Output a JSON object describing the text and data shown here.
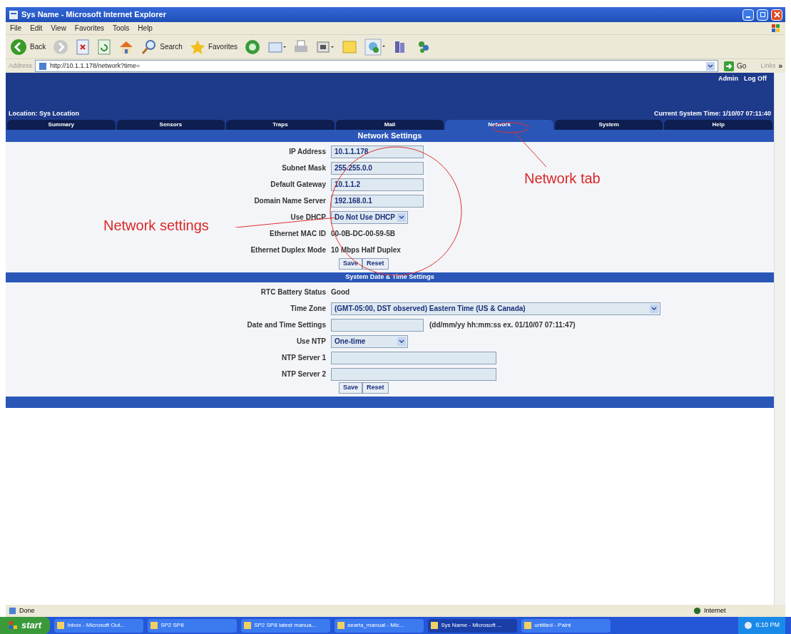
{
  "window": {
    "title": "Sys Name - Microsoft Internet Explorer"
  },
  "menu": [
    "File",
    "Edit",
    "View",
    "Favorites",
    "Tools",
    "Help"
  ],
  "toolbar": [
    {
      "kind": "back",
      "label": "Back"
    },
    {
      "kind": "forward"
    },
    {
      "kind": "stop"
    },
    {
      "kind": "refresh"
    },
    {
      "kind": "home"
    },
    {
      "kind": "search",
      "label": "Search"
    },
    {
      "kind": "favorites",
      "label": "Favorites"
    },
    {
      "kind": "media"
    },
    {
      "kind": "mail"
    },
    {
      "kind": "print"
    },
    {
      "kind": "edit"
    },
    {
      "kind": "folder"
    },
    {
      "kind": "discuss"
    },
    {
      "kind": "research"
    },
    {
      "kind": "messenger"
    }
  ],
  "address": {
    "label": "Address",
    "value": "http://10.1.1.178/network?time=",
    "go": "Go",
    "links": "Links",
    "more": "»"
  },
  "header": {
    "user": "Admin",
    "logoff": "Log Off",
    "location": "Location: Sys Location",
    "time": "Current System Time: 1/10/07 07:11:40"
  },
  "tabs": [
    {
      "label": "Summary",
      "selected": false
    },
    {
      "label": "Sensors",
      "selected": false
    },
    {
      "label": "Traps",
      "selected": false
    },
    {
      "label": "Mail",
      "selected": false
    },
    {
      "label": "Network",
      "selected": true
    },
    {
      "label": "System",
      "selected": false
    },
    {
      "label": "Help",
      "selected": false
    }
  ],
  "sections": [
    {
      "title": "Network Settings",
      "rows": [
        {
          "kind": "input",
          "label": "IP Address",
          "value": "10.1.1.178"
        },
        {
          "kind": "input",
          "label": "Subnet Mask",
          "value": "255.255.0.0"
        },
        {
          "kind": "input",
          "label": "Default Gateway",
          "value": "10.1.1.2"
        },
        {
          "kind": "input",
          "label": "Domain Name Server",
          "value": "192.168.0.1"
        },
        {
          "kind": "select",
          "label": "Use DHCP",
          "value": "Do Not Use DHCP"
        },
        {
          "kind": "text",
          "label": "Ethernet MAC ID",
          "value": "00-0B-DC-00-59-5B"
        },
        {
          "kind": "text",
          "label": "Ethernet Duplex Mode",
          "value": "10 Mbps Half Duplex"
        }
      ],
      "buttons": [
        "Save",
        "Reset"
      ]
    },
    {
      "title": "System Date & Time Settings",
      "rows": [
        {
          "kind": "text",
          "label": "RTC Battery Status",
          "value": "Good"
        },
        {
          "kind": "wide-select",
          "label": "Time Zone",
          "value": "(GMT-05:00, DST observed) Eastern Time (US & Canada)"
        },
        {
          "kind": "input",
          "label": "Date and Time Settings",
          "value": "",
          "hint": "(dd/mm/yy hh:mm:ss ex. 01/10/07 07:11:47)"
        },
        {
          "kind": "select",
          "label": "Use NTP",
          "value": "One-time"
        },
        {
          "kind": "long-input",
          "label": "NTP Server 1",
          "value": ""
        },
        {
          "kind": "long-input",
          "label": "NTP Server 2",
          "value": ""
        }
      ],
      "buttons": [
        "Save",
        "Reset"
      ]
    }
  ],
  "annotations": [
    {
      "label": "Network settings"
    },
    {
      "label": "Network tab"
    }
  ],
  "status_bar": {
    "text": "Done",
    "zone": "Internet"
  },
  "taskbar": {
    "start": "start",
    "items": [
      {
        "label": "Inbox - Microsoft Out...",
        "selected": false
      },
      {
        "label": "SP2 SP8",
        "selected": false
      },
      {
        "label": "SP2 SP8 latest manua...",
        "selected": false
      },
      {
        "label": "searta_manual - Mic...",
        "selected": false
      },
      {
        "label": "Sys Name - Microsoft ...",
        "selected": true
      },
      {
        "label": "untitled - Paint",
        "selected": false
      }
    ],
    "clock": "6:10 PM"
  }
}
